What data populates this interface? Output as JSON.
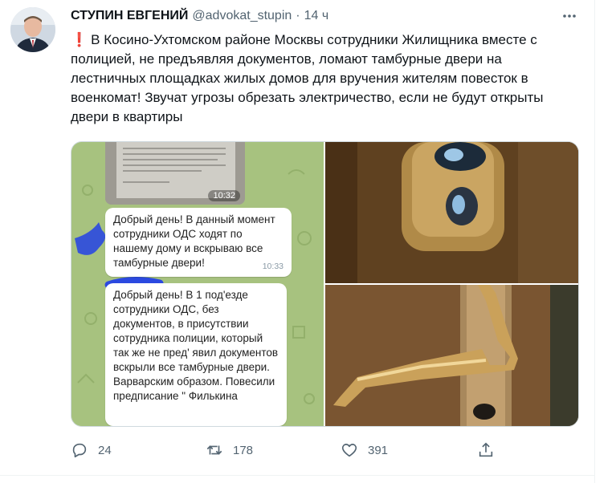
{
  "tweet": {
    "author_name": "СТУПИН ЕВГЕНИЙ",
    "handle": "@advokat_stupin",
    "separator": "·",
    "time": "14 ч",
    "text_marker": "❗",
    "text": "В Косино-Ухтомском районе Москвы сотрудники Жилищника вместе с полицией, не предъявляя документов, ломают тамбурные двери на лестничных площадках жилых домов для вручения жителям повесток в военкомат! Звучат угрозы обрезать электричество, если не будут открыты двери в квартиры"
  },
  "media": {
    "chat_image_time": "10:32",
    "message1": {
      "text": "Добрый день! В данный момент сотрудники ОДС ходят по нашему дому и вскрываю все тамбурные двери!",
      "time": "10:33"
    },
    "message2": {
      "text": "Добрый день! В 1 под'езде сотрудники ОДС, без документов, в присутствии сотрудника полиции, который так же не пред' явил документов вскрыли все тамбурные двери. Варварским образом. Повесили предписание \" Филькина"
    }
  },
  "actions": {
    "replies": "24",
    "retweets": "178",
    "likes": "391"
  },
  "colors": {
    "accent_red": "#d0202f",
    "secondary_text": "#536471",
    "chat_background": "#a7c27f"
  },
  "icons": [
    "more-icon",
    "reply-icon",
    "retweet-icon",
    "like-icon",
    "share-icon"
  ]
}
